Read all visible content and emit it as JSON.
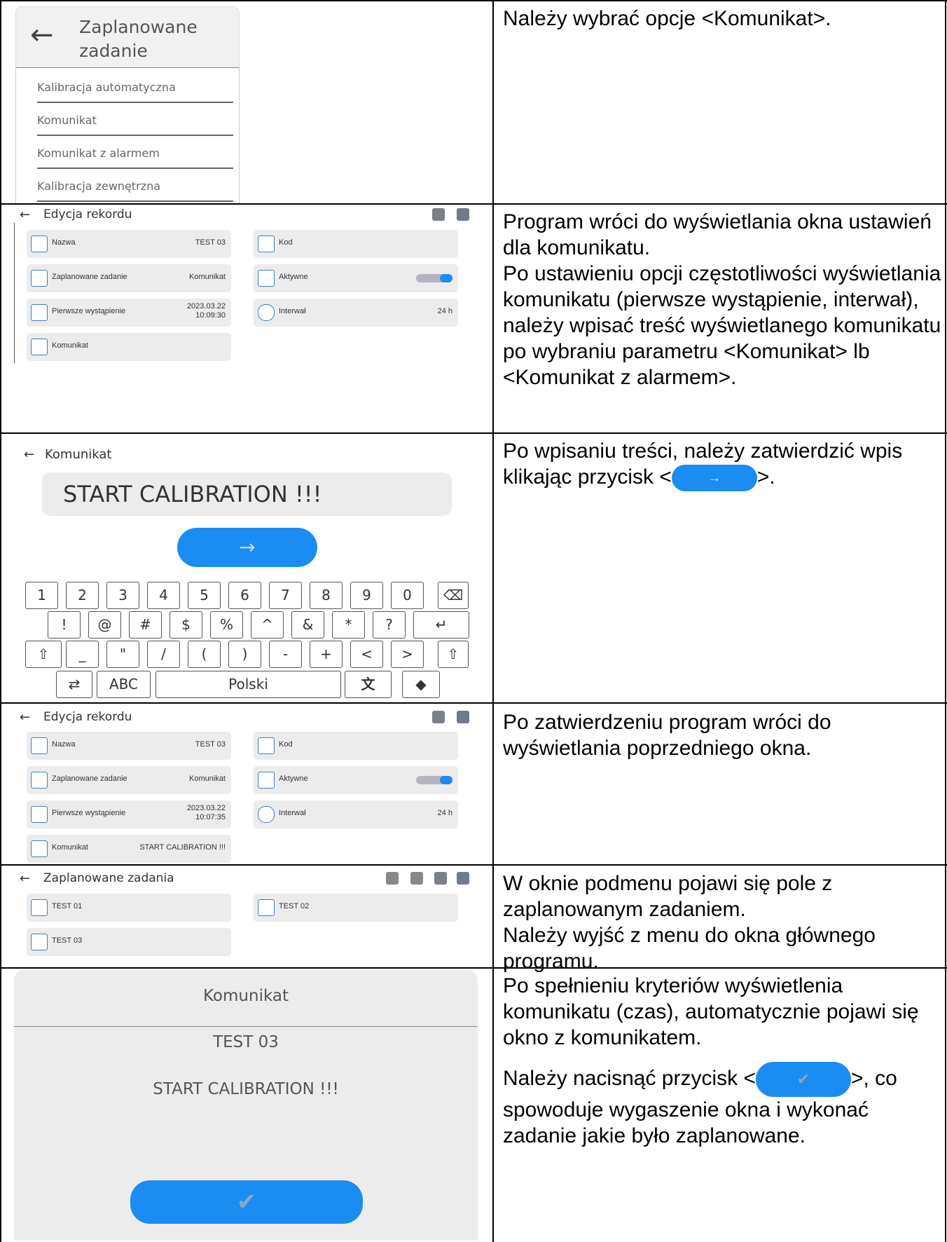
{
  "rows": [
    {
      "text": [
        "Należy wybrać opcje <Komunikat>."
      ]
    },
    {
      "text": [
        "Program wróci do wyświetlania okna ustawień dla komunikatu.",
        "Po ustawieniu opcji częstotliwości wyświetlania komunikatu (pierwsze wystąpienie, interwał), należy wpisać treść wyświetlanego komunikatu po wybraniu parametru <Komunikat> lb <Komunikat z alarmem>."
      ]
    },
    {
      "text_before": "Po wpisaniu treści, należy zatwierdzić wpis klikając przycisk <",
      "text_after": ">."
    },
    {
      "text": [
        "Po zatwierdzeniu program wróci do wyświetlania poprzedniego okna."
      ]
    },
    {
      "text": [
        "W oknie podmenu pojawi się pole z zaplanowanym zadaniem.",
        "Należy wyjść z menu do okna głównego programu."
      ]
    },
    {
      "text": [
        "Po spełnieniu kryteriów wyświetlenia komunikatu (czas), automatycznie pojawi się okno z komunikatem."
      ],
      "text2_before": "Należy nacisnąć przycisk <",
      "text2_after": ">, co spowoduje wygaszenie okna i wykonać zadanie jakie było zaplanowane."
    }
  ],
  "screen1": {
    "title": "Zaplanowane zadanie",
    "items": [
      "Kalibracja automatyczna",
      "Komunikat",
      "Komunikat z alarmem",
      "Kalibracja zewnętrzna"
    ]
  },
  "screen2": {
    "title": "Edycja rekordu",
    "tiles": {
      "nazwa_label": "Nazwa",
      "nazwa_value": "TEST 03",
      "kod_label": "Kod",
      "zadanie_label": "Zaplanowane zadanie",
      "zadanie_value": "Komunikat",
      "aktywne_label": "Aktywne",
      "pierwsze_label": "Pierwsze wystąpienie",
      "pierwsze_date": "2023.03.22",
      "pierwsze_time": "10:09:30",
      "interwal_label": "Interwał",
      "interwal_value": "24 h",
      "komunikat_label": "Komunikat",
      "komunikat_value": ""
    }
  },
  "screen3": {
    "title": "Komunikat",
    "input_value": "START CALIBRATION !!!",
    "row1": [
      "1",
      "2",
      "3",
      "4",
      "5",
      "6",
      "7",
      "8",
      "9",
      "0"
    ],
    "row2": [
      "!",
      "@",
      "#",
      "$",
      "%",
      "^",
      "&",
      "*",
      "?"
    ],
    "row3": [
      "_",
      "\"",
      "/",
      "(",
      ")",
      "-",
      "+",
      "<",
      ">"
    ],
    "abc": "ABC",
    "lang": "Polski"
  },
  "screen4": {
    "title": "Edycja rekordu",
    "tiles": {
      "nazwa_label": "Nazwa",
      "nazwa_value": "TEST 03",
      "kod_label": "Kod",
      "zadanie_label": "Zaplanowane zadanie",
      "zadanie_value": "Komunikat",
      "aktywne_label": "Aktywne",
      "pierwsze_label": "Pierwsze wystąpienie",
      "pierwsze_date": "2023.03.22",
      "pierwsze_time": "10:07:35",
      "interwal_label": "Interwał",
      "interwal_value": "24 h",
      "komunikat_label": "Komunikat",
      "komunikat_value": "START CALIBRATION !!!"
    }
  },
  "screen5": {
    "title": "Zaplanowane zadania",
    "tasks": [
      "TEST 01",
      "TEST 02",
      "TEST 03"
    ]
  },
  "screen6": {
    "title": "Komunikat",
    "name": "TEST 03",
    "message": "START CALIBRATION !!!"
  },
  "colors": {
    "accent": "#1a8cf2",
    "tile": "#ececec",
    "icon_blue": "#3d7ebf"
  }
}
